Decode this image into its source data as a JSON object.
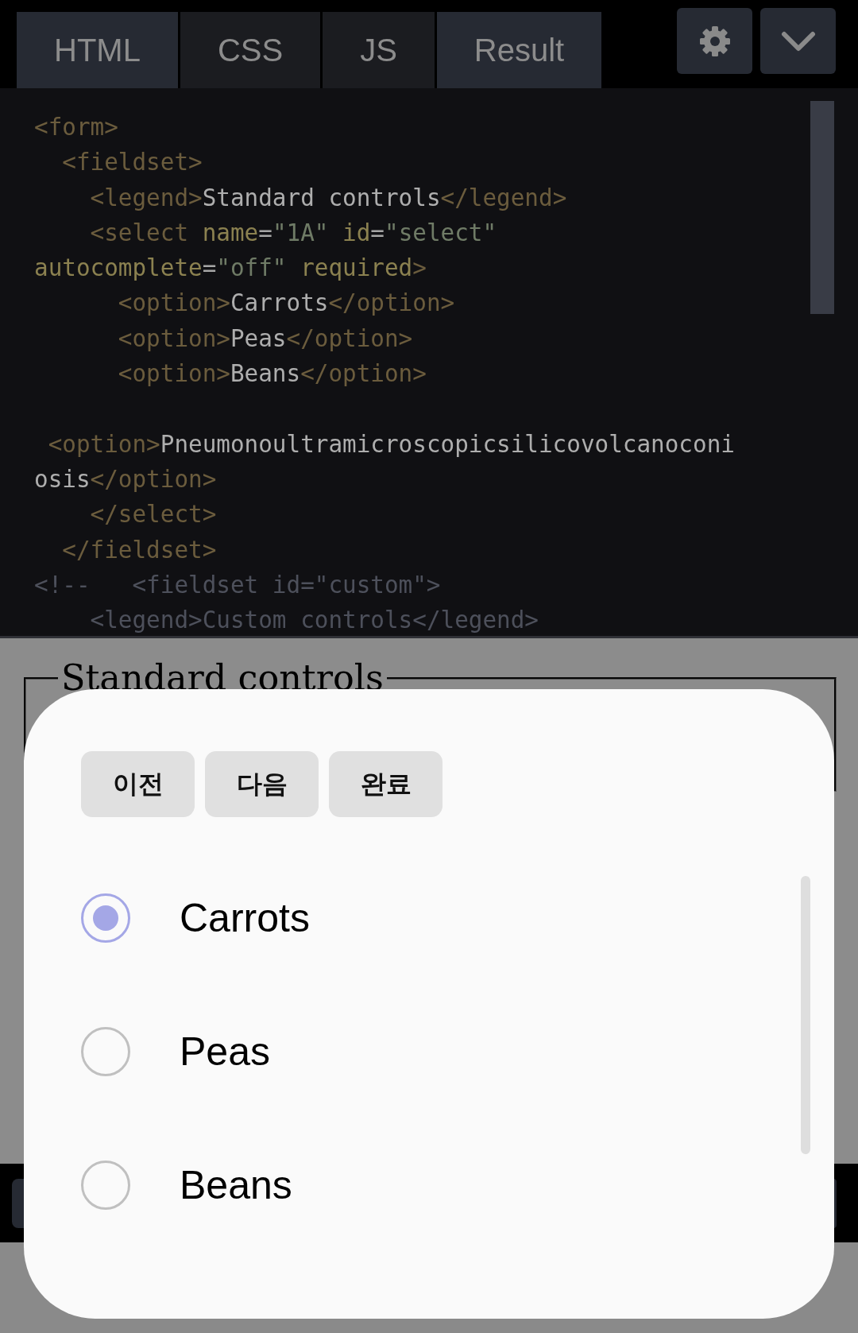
{
  "top_bar": {
    "tabs": [
      {
        "label": "HTML",
        "selected": true
      },
      {
        "label": "CSS",
        "selected": false
      },
      {
        "label": "JS",
        "selected": false
      },
      {
        "label": "Result",
        "selected": true
      }
    ]
  },
  "editor": {
    "lines": [
      {
        "kind": "code",
        "tokens": [
          {
            "kind": "tag",
            "text": "<form>"
          }
        ]
      },
      {
        "kind": "code",
        "tokens": [
          {
            "kind": "tag",
            "text": "  <fieldset>"
          }
        ]
      },
      {
        "kind": "code",
        "tokens": [
          {
            "kind": "tag",
            "text": "    <legend>"
          },
          {
            "kind": "text",
            "text": "Standard controls"
          },
          {
            "kind": "tag",
            "text": "</legend>"
          }
        ]
      },
      {
        "kind": "code",
        "tokens": [
          {
            "kind": "tag",
            "text": "    <select"
          },
          {
            "kind": "attr",
            "text": " name"
          },
          {
            "kind": "punct",
            "text": "="
          },
          {
            "kind": "string",
            "text": "\"1A\""
          },
          {
            "kind": "attr",
            "text": " id"
          },
          {
            "kind": "punct",
            "text": "="
          },
          {
            "kind": "string",
            "text": "\"select\""
          }
        ]
      },
      {
        "kind": "code",
        "tokens": [
          {
            "kind": "attr",
            "text": "autocomplete"
          },
          {
            "kind": "punct",
            "text": "="
          },
          {
            "kind": "string",
            "text": "\"off\""
          },
          {
            "kind": "attr",
            "text": " required"
          },
          {
            "kind": "tag",
            "text": ">"
          }
        ]
      },
      {
        "kind": "code",
        "tokens": [
          {
            "kind": "tag",
            "text": "      <option>"
          },
          {
            "kind": "text",
            "text": "Carrots"
          },
          {
            "kind": "tag",
            "text": "</option>"
          }
        ]
      },
      {
        "kind": "code",
        "tokens": [
          {
            "kind": "tag",
            "text": "      <option>"
          },
          {
            "kind": "text",
            "text": "Peas"
          },
          {
            "kind": "tag",
            "text": "</option>"
          }
        ]
      },
      {
        "kind": "code",
        "tokens": [
          {
            "kind": "tag",
            "text": "      <option>"
          },
          {
            "kind": "text",
            "text": "Beans"
          },
          {
            "kind": "tag",
            "text": "</option>"
          }
        ]
      },
      {
        "kind": "blank"
      },
      {
        "kind": "code",
        "tokens": [
          {
            "kind": "tag",
            "text": " <option>"
          },
          {
            "kind": "text",
            "text": "Pneumonoultramicroscopicsilicovolcanoconi"
          }
        ]
      },
      {
        "kind": "code",
        "tokens": [
          {
            "kind": "text",
            "text": "osis"
          },
          {
            "kind": "tag",
            "text": "</option>"
          }
        ]
      },
      {
        "kind": "code",
        "tokens": [
          {
            "kind": "tag",
            "text": "    </select>"
          }
        ]
      },
      {
        "kind": "code",
        "tokens": [
          {
            "kind": "tag",
            "text": "  </fieldset>"
          }
        ]
      },
      {
        "kind": "code",
        "tokens": [
          {
            "kind": "comment",
            "text": "<!--   <fieldset id=\"custom\">"
          }
        ]
      },
      {
        "kind": "code",
        "tokens": [
          {
            "kind": "comment",
            "text": "    <legend>Custom controls</legend>"
          }
        ]
      }
    ]
  },
  "result": {
    "legend": "Standard controls"
  },
  "picker": {
    "buttons": [
      "이전",
      "다음",
      "완료"
    ],
    "options": [
      {
        "label": "Carrots",
        "selected": true
      },
      {
        "label": "Peas",
        "selected": false
      },
      {
        "label": "Beans",
        "selected": false
      }
    ]
  }
}
